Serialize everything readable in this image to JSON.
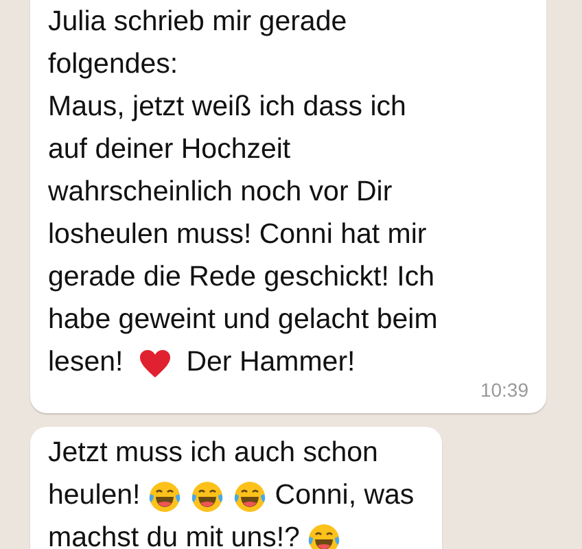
{
  "messages": [
    {
      "time": "10:39",
      "lines": [
        [
          {
            "kind": "text",
            "text": "Julia schrieb mir gerade"
          }
        ],
        [
          {
            "kind": "text",
            "text": "folgendes:"
          }
        ],
        [
          {
            "kind": "text",
            "text": "Maus, jetzt weiß ich dass ich"
          }
        ],
        [
          {
            "kind": "text",
            "text": "auf deiner Hochzeit"
          }
        ],
        [
          {
            "kind": "text",
            "text": "wahrscheinlich noch vor Dir"
          }
        ],
        [
          {
            "kind": "text",
            "text": "losheulen muss! Conni hat mir"
          }
        ],
        [
          {
            "kind": "text",
            "text": "gerade die Rede geschickt! Ich"
          }
        ],
        [
          {
            "kind": "text",
            "text": "habe geweint und gelacht beim"
          }
        ],
        [
          {
            "kind": "text",
            "text": "lesen!"
          },
          {
            "kind": "heart"
          },
          {
            "kind": "text",
            "text": "Der Hammer!"
          }
        ]
      ]
    },
    {
      "lines": [
        [
          {
            "kind": "text",
            "text": "Jetzt muss ich auch schon"
          }
        ],
        [
          {
            "kind": "text",
            "text": "heulen!"
          },
          {
            "kind": "laugh"
          },
          {
            "kind": "laugh"
          },
          {
            "kind": "laugh"
          },
          {
            "kind": "text",
            "text": "Conni, was"
          }
        ],
        [
          {
            "kind": "text",
            "text": "machst du mit uns!?"
          },
          {
            "kind": "laugh"
          }
        ]
      ]
    }
  ]
}
